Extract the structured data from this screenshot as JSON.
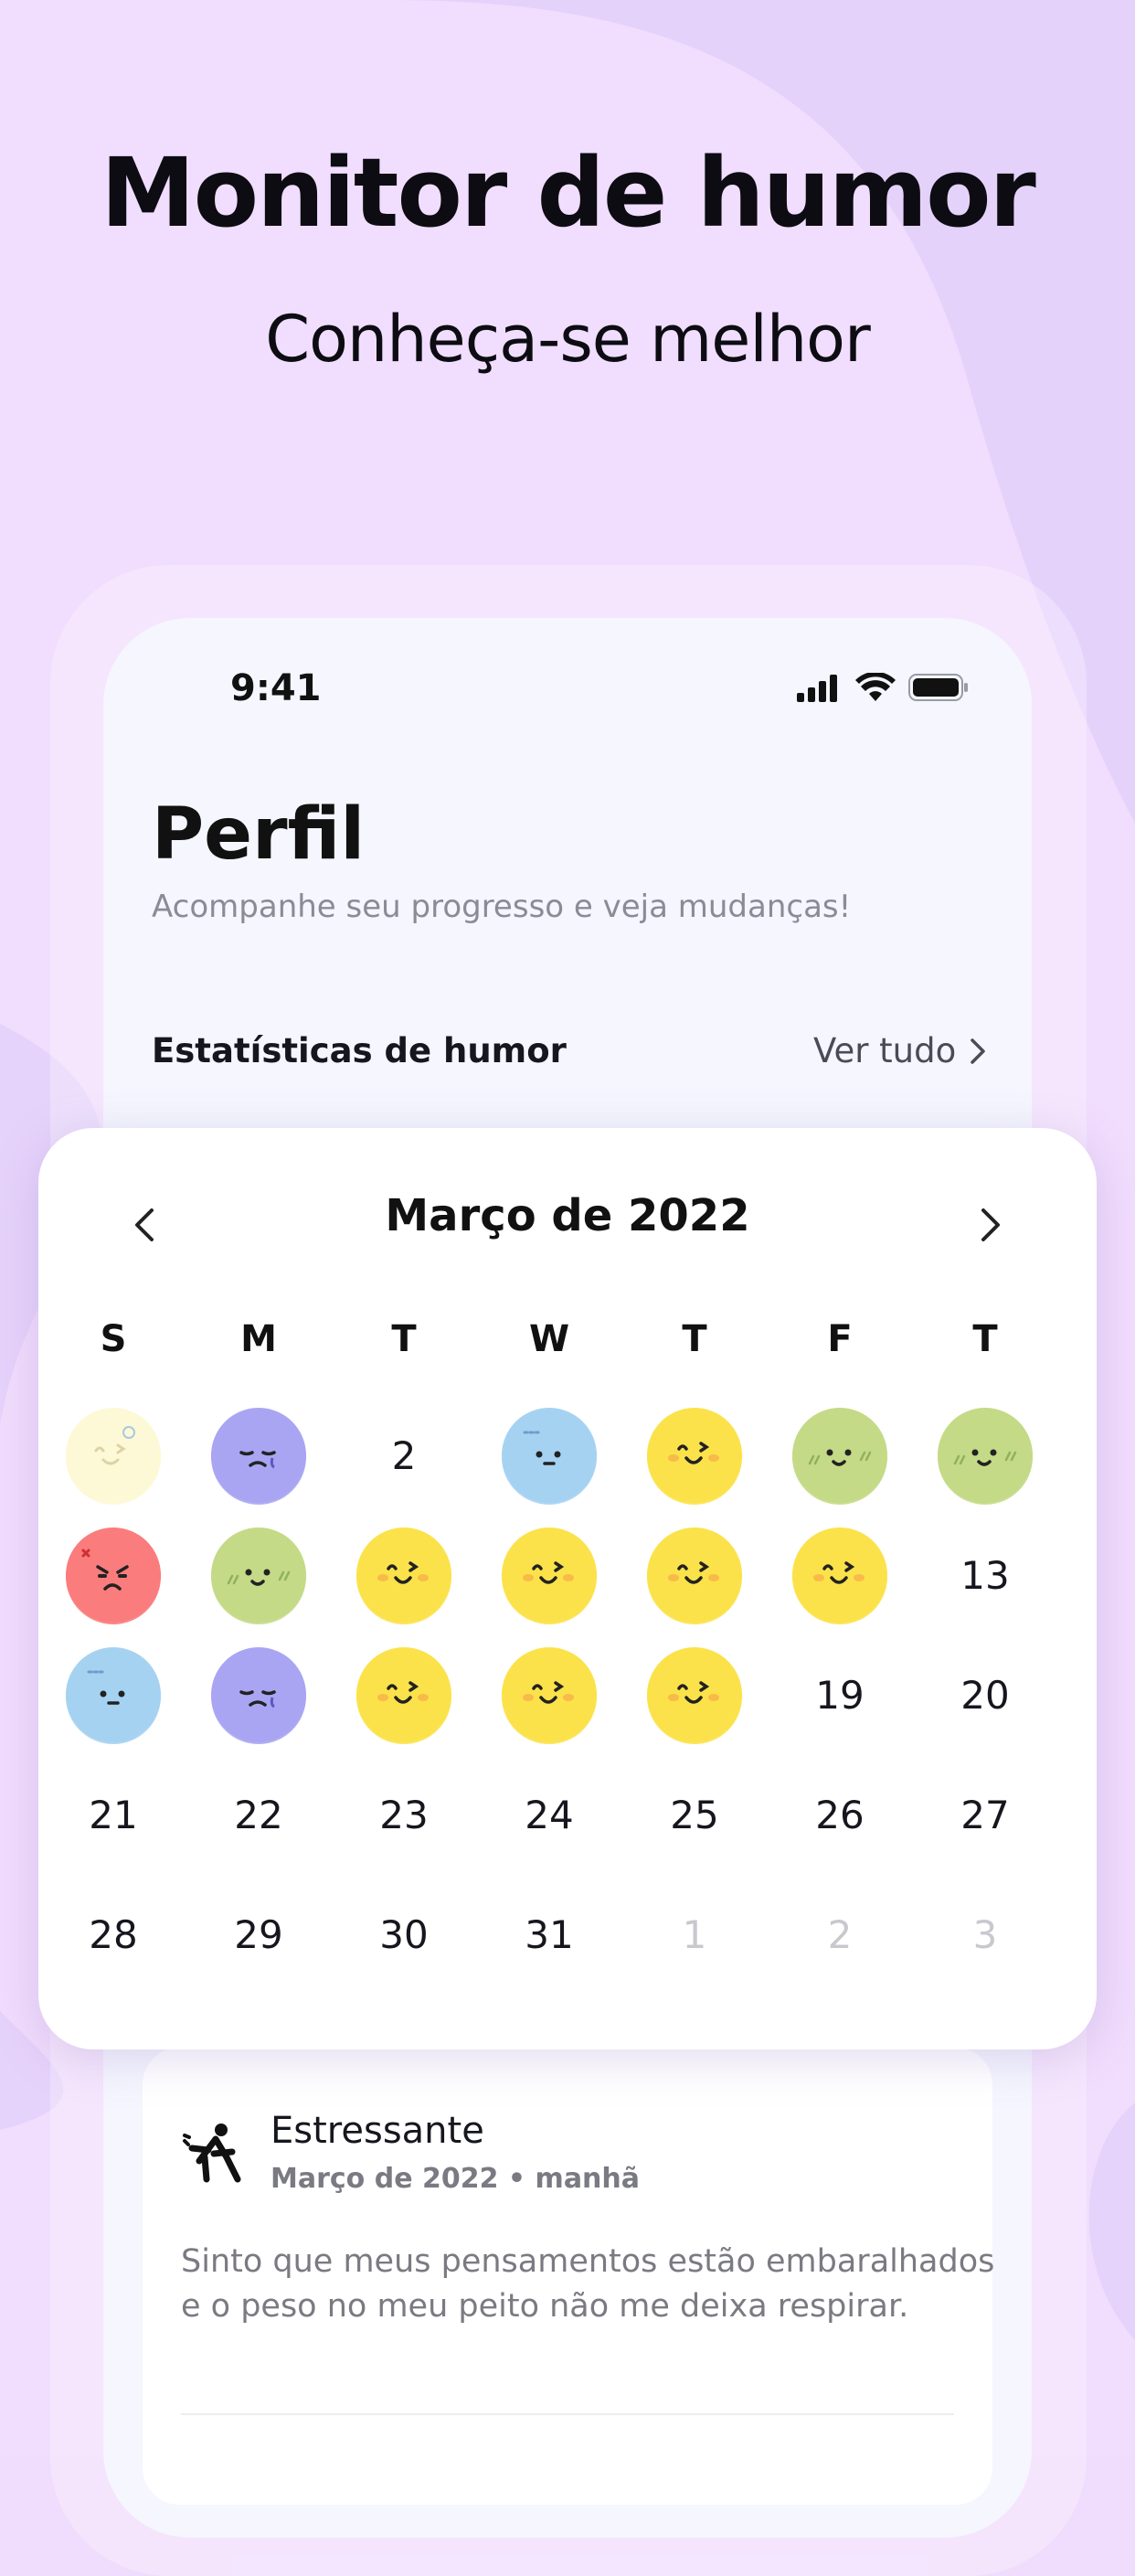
{
  "hero": {
    "title": "Monitor de humor",
    "subtitle": "Conheça-se melhor"
  },
  "status_bar": {
    "time": "9:41",
    "icons": [
      "signal-icon",
      "wifi-icon",
      "battery-icon"
    ]
  },
  "profile": {
    "title": "Perfil",
    "subtitle": "Acompanhe seu progresso e veja mudanças!",
    "stats_title": "Estatísticas de humor",
    "see_all": "Ver tudo"
  },
  "calendar": {
    "month_label": "Março de 2022",
    "weekdays": [
      "S",
      "M",
      "T",
      "W",
      "T",
      "F",
      "T"
    ],
    "weeks": [
      [
        {
          "mood": "cream"
        },
        {
          "mood": "sad"
        },
        {
          "day": "2"
        },
        {
          "mood": "calm"
        },
        {
          "mood": "happy"
        },
        {
          "mood": "content"
        },
        {
          "mood": "content"
        }
      ],
      [
        {
          "mood": "angry"
        },
        {
          "mood": "content"
        },
        {
          "mood": "happy"
        },
        {
          "mood": "happy"
        },
        {
          "mood": "happy"
        },
        {
          "mood": "happy"
        },
        {
          "day": "13"
        }
      ],
      [
        {
          "mood": "calm"
        },
        {
          "mood": "sad"
        },
        {
          "mood": "happy"
        },
        {
          "mood": "happy"
        },
        {
          "mood": "happy"
        },
        {
          "day": "19"
        },
        {
          "day": "20"
        }
      ],
      [
        {
          "day": "21"
        },
        {
          "day": "22"
        },
        {
          "day": "23"
        },
        {
          "day": "24"
        },
        {
          "day": "25"
        },
        {
          "day": "26"
        },
        {
          "day": "27"
        }
      ],
      [
        {
          "day": "28"
        },
        {
          "day": "29"
        },
        {
          "day": "30"
        },
        {
          "day": "31"
        },
        {
          "day": "1",
          "muted": true
        },
        {
          "day": "2",
          "muted": true
        },
        {
          "day": "3",
          "muted": true
        }
      ]
    ],
    "mood_colors": {
      "cream": "#fdf8d6",
      "sad": "#a9a5f3",
      "calm": "#a6d2f2",
      "happy": "#fbe24a",
      "content": "#c4da86",
      "angry": "#fa7c7d"
    }
  },
  "entry": {
    "icon": "stressed-figure-icon",
    "title": "Estressante",
    "meta": "Março de 2022 • manhã",
    "text_lines": [
      "Sinto que meus pensamentos estão embaralhados",
      "e o peso no meu peito não me deixa respirar."
    ]
  }
}
